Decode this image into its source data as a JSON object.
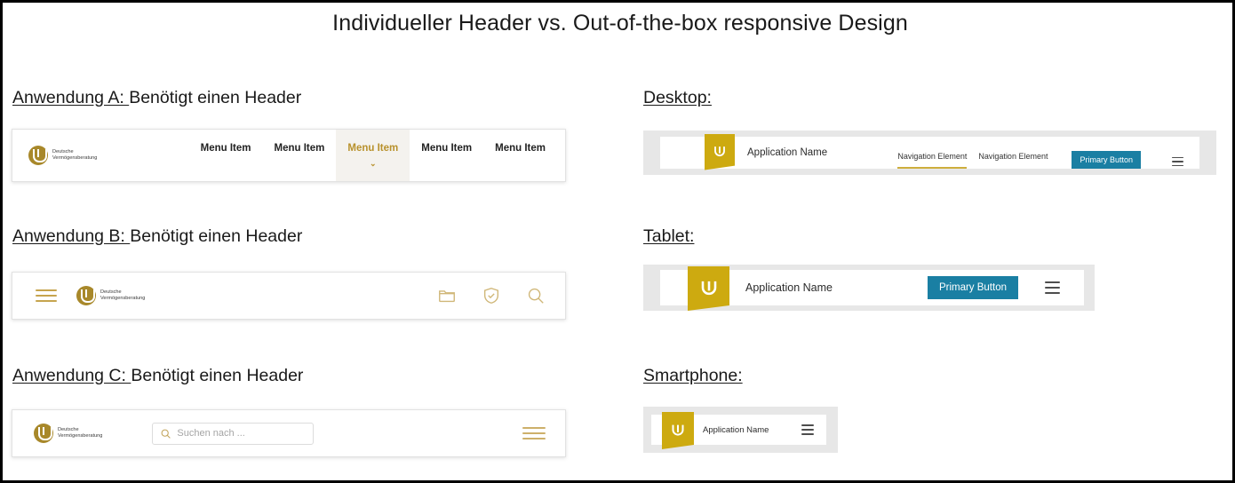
{
  "slide": {
    "title": "Individueller Header vs. Out-of-the-box responsive Design"
  },
  "colors": {
    "gold": "#cdaa10",
    "logo_gold": "#a8882a",
    "accent_gold": "#b8912c",
    "primary_button": "#1a7fa3",
    "frame_gray": "#e7e7e7",
    "border": "#000000"
  },
  "left_column": {
    "sections": [
      {
        "label_underlined": "Anwendung A: ",
        "label_rest": "Benötigt einen Header",
        "header": {
          "logo": {
            "icon": "dvag-logo-icon",
            "line1": "Deutsche",
            "line2": "Vermögensberatung"
          },
          "menu_items": [
            {
              "label": "Menu Item",
              "active": false
            },
            {
              "label": "Menu Item",
              "active": false
            },
            {
              "label": "Menu Item",
              "active": true
            },
            {
              "label": "Menu Item",
              "active": false
            },
            {
              "label": "Menu Item",
              "active": false
            }
          ],
          "chevron": "⌄"
        }
      },
      {
        "label_underlined": "Anwendung B: ",
        "label_rest": "Benötigt einen Header",
        "header": {
          "menu_icon": "hamburger-menu-icon",
          "logo": {
            "icon": "dvag-logo-icon",
            "line1": "Deutsche",
            "line2": "Vermögensberatung"
          },
          "icons": [
            "folder-icon",
            "shield-check-icon",
            "search-icon"
          ]
        }
      },
      {
        "label_underlined": "Anwendung C: ",
        "label_rest": "Benötigt einen Header",
        "header": {
          "logo": {
            "icon": "dvag-logo-icon",
            "line1": "Deutsche",
            "line2": "Vermögensberatung"
          },
          "search": {
            "icon": "search-icon",
            "placeholder": "Suchen nach ...",
            "value": ""
          },
          "menu_icon": "hamburger-menu-icon"
        }
      }
    ]
  },
  "right_column": {
    "sections": [
      {
        "label": "Desktop:",
        "header": {
          "logo_icon": "dvag-square-logo-icon",
          "app_name": "Application Name",
          "nav_elements": [
            {
              "label": "Navigation Element",
              "active": true
            },
            {
              "label": "Navigation Element",
              "active": false
            }
          ],
          "primary_button": "Primary Button",
          "menu_icon": "hamburger-menu-icon"
        }
      },
      {
        "label": "Tablet:",
        "header": {
          "logo_icon": "dvag-square-logo-icon",
          "app_name": "Application Name",
          "primary_button": "Primary Button",
          "menu_icon": "hamburger-menu-icon"
        }
      },
      {
        "label": "Smartphone:",
        "header": {
          "logo_icon": "dvag-square-logo-icon",
          "app_name": "Application Name",
          "menu_icon": "hamburger-menu-icon"
        }
      }
    ]
  }
}
